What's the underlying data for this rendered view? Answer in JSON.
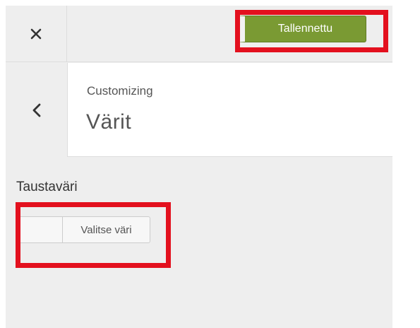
{
  "header": {
    "close_icon": "close-icon",
    "save_label": "Tallennettu"
  },
  "section": {
    "back_icon": "chevron-left-icon",
    "breadcrumb": "Customizing",
    "title": "Värit"
  },
  "control": {
    "label": "Taustaväri",
    "picker_label": "Valitse väri"
  },
  "colors": {
    "save_button": "#7a9a33",
    "highlight": "#e3101e",
    "panel_bg": "#eeeeee"
  }
}
